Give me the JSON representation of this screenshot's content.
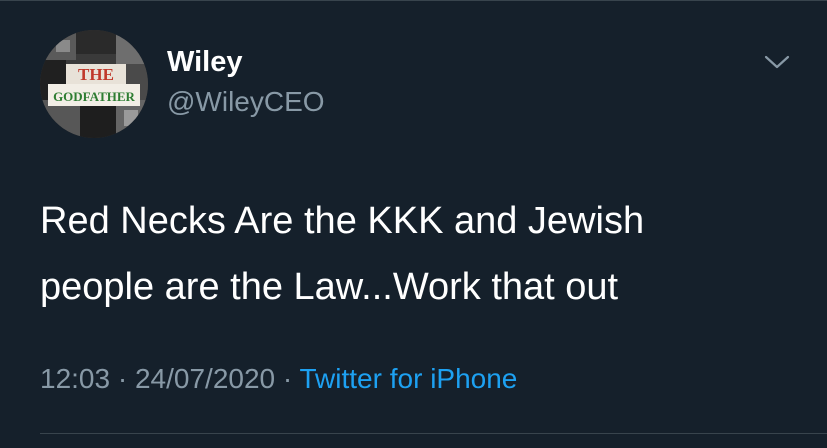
{
  "author": {
    "display_name": "Wiley",
    "handle": "@WileyCEO",
    "avatar_text_line1": "THE",
    "avatar_text_line2": "GODFATHER"
  },
  "tweet": {
    "text": "Red Necks Are the KKK and Jewish\npeople are the Law...Work that out",
    "time": "12:03",
    "separator": "·",
    "date": "24/07/2020",
    "source": "Twitter for iPhone"
  },
  "icons": {
    "menu": "chevron-down-icon"
  },
  "colors": {
    "background": "#15202b",
    "primary_text": "#ffffff",
    "secondary_text": "#8899a6",
    "link": "#1da1f2",
    "divider": "#38444d"
  }
}
